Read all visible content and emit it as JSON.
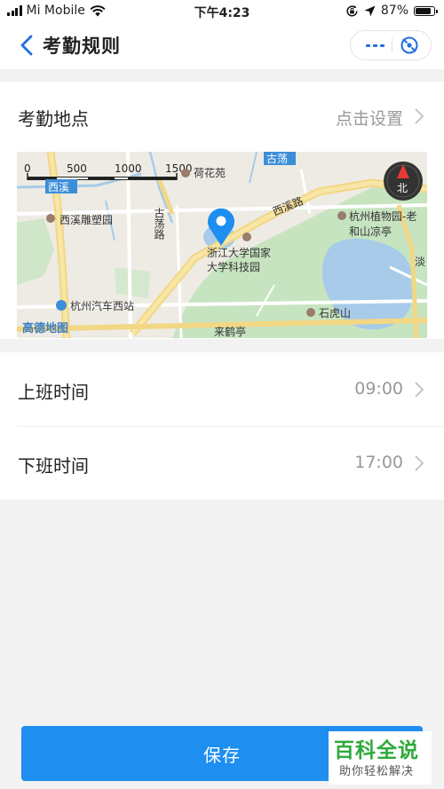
{
  "status_bar": {
    "carrier": "Mi Mobile",
    "time": "下午4:23",
    "battery": "87%",
    "battery_level": 0.87
  },
  "nav": {
    "title": "考勤规则"
  },
  "location": {
    "label": "考勤地点",
    "value": "点击设置",
    "map": {
      "scale_labels": [
        "0",
        "500",
        "1000",
        "1500"
      ],
      "compass_label": "北",
      "logo": "高德地图",
      "places": {
        "hehuayuan": "荷花苑",
        "gudang": "古荡",
        "xixi_box": "西溪",
        "xixi_diaosu": "西溪雕塑园",
        "gudang_road": "古荡路",
        "xixi_road": "西溪路",
        "botanical_1": "杭州植物园-老",
        "botanical_2": "和山凉亭",
        "zju_1": "浙江大学国家",
        "zju_2": "大学科技园",
        "bus_station": "杭州汽车西站",
        "shihushan": "石虎山",
        "laihe": "来鹤亭",
        "edge": "淡"
      }
    }
  },
  "times": [
    {
      "label": "上班时间",
      "value": "09:00"
    },
    {
      "label": "下班时间",
      "value": "17:00"
    }
  ],
  "save_label": "保存",
  "watermark": {
    "title": "百科全说",
    "subtitle": "助你轻松解决"
  }
}
